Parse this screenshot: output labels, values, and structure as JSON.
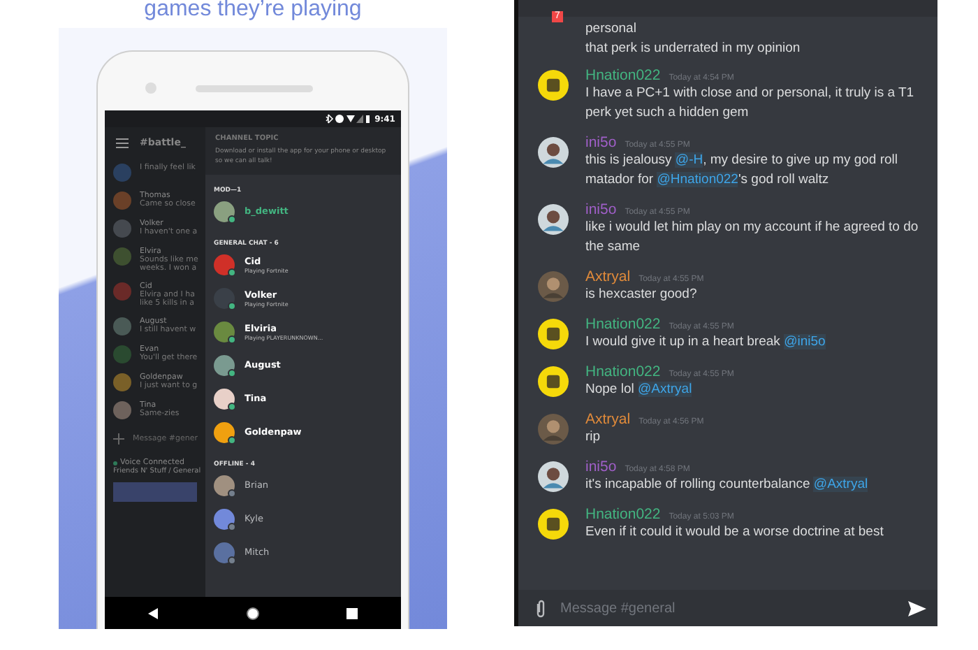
{
  "promo": {
    "headline": "games they’re playing"
  },
  "phone": {
    "status_time": "9:41",
    "chat": {
      "channel": "#battle_",
      "messages": [
        {
          "lines": [
            "I finally feel lik"
          ],
          "color": "#2a4060"
        },
        {
          "author": "Thomas",
          "lines": [
            "Came so close"
          ],
          "color": "#6a4028"
        },
        {
          "author": "Volker",
          "lines": [
            "I haven't one a"
          ],
          "color": "#45494f"
        },
        {
          "author": "Elvira",
          "lines": [
            "Sounds like me",
            "weeks. I won a"
          ],
          "color": "#3e5030"
        },
        {
          "author": "Cid",
          "lines": [
            "Elvira and I ha",
            "like 5 kills in a"
          ],
          "color": "#6a2a28"
        },
        {
          "author": "August",
          "lines": [
            "I still havent w"
          ],
          "color": "#4a5a56"
        },
        {
          "author": "Evan",
          "lines": [
            "You'll get there"
          ],
          "color": "#2a4a30"
        },
        {
          "author": "Goldenpaw",
          "lines": [
            "I just want to g"
          ],
          "color": "#7a6028"
        },
        {
          "author": "Tina",
          "lines": [
            "Same-zies"
          ],
          "color": "#6e625c"
        }
      ],
      "input_placeholder": "Message #gener",
      "voice_status": "Voice Connected",
      "voice_channel": "Friends N' Stuff / General"
    },
    "drawer": {
      "topic_heading": "CHANNEL TOPIC",
      "topic": "Download or install the app for your phone or desktop so we can all talk!",
      "groups": [
        {
          "heading": "MOD—1",
          "members": [
            {
              "name": "b_dewitt",
              "online": true,
              "highlight": true,
              "color": "#8aa080"
            }
          ]
        },
        {
          "heading": "GENERAL CHAT - 6",
          "members": [
            {
              "name": "Cid",
              "activity": "Playing Fortnite",
              "online": true,
              "highlight": false,
              "color": "#d03028"
            },
            {
              "name": "Volker",
              "activity": "Playing Fortnite",
              "online": true,
              "highlight": false,
              "color": "#3a4048"
            },
            {
              "name": "Elviria",
              "activity": "Playing PLAYERUNKNOWN...",
              "online": true,
              "highlight": false,
              "color": "#6a8a40"
            },
            {
              "name": "August",
              "online": true,
              "highlight": false,
              "color": "#7a9a90"
            },
            {
              "name": "Tina",
              "online": true,
              "highlight": false,
              "color": "#e8d0c8"
            },
            {
              "name": "Goldenpaw",
              "online": true,
              "highlight": false,
              "color": "#f0a010"
            }
          ]
        },
        {
          "heading": "OFFLINE - 4",
          "members": [
            {
              "name": "Brian",
              "online": false,
              "highlight": false,
              "color": "#a09080"
            },
            {
              "name": "Kyle",
              "online": false,
              "highlight": false,
              "color": "#7289da"
            },
            {
              "name": "Mitch",
              "online": false,
              "highlight": false,
              "color": "#5a70a0"
            }
          ]
        }
      ]
    }
  },
  "chat": {
    "badge": "7",
    "continuation": [
      "personal",
      "that perk is underrated in my opinion"
    ],
    "messages": [
      {
        "author": "Hnation022",
        "color": "#43b581",
        "kind": "logo",
        "time": "Today at 4:54 PM",
        "parts": [
          {
            "kind": "text",
            "text": "I have a PC+1 with close and or personal, it truly is a T1 perk yet such a hidden gem"
          }
        ]
      },
      {
        "author": "ini5o",
        "color": "#a05fc8",
        "kind": "person",
        "time": "Today at 4:55 PM",
        "parts": [
          {
            "kind": "text",
            "text": "this is jealousy "
          },
          {
            "kind": "mention",
            "text": "@-H"
          },
          {
            "kind": "text",
            "text": ", my desire to give up my god roll matador for "
          },
          {
            "kind": "mention",
            "text": "@Hnation022"
          },
          {
            "kind": "text",
            "text": "'s god roll waltz"
          }
        ]
      },
      {
        "author": "ini5o",
        "color": "#a05fc8",
        "kind": "person",
        "time": "Today at 4:55 PM",
        "parts": [
          {
            "kind": "text",
            "text": "like i would let him play on my account if he agreed to do the same"
          }
        ]
      },
      {
        "author": "Axtryal",
        "color": "#e08a3a",
        "kind": "character",
        "time": "Today at 4:55 PM",
        "parts": [
          {
            "kind": "text",
            "text": "is hexcaster good?"
          }
        ]
      },
      {
        "author": "Hnation022",
        "color": "#43b581",
        "kind": "logo",
        "time": "Today at 4:55 PM",
        "parts": [
          {
            "kind": "text",
            "text": "I would give it up in a heart break "
          },
          {
            "kind": "mention",
            "text": "@ini5o"
          }
        ]
      },
      {
        "author": "Hnation022",
        "color": "#43b581",
        "kind": "logo",
        "time": "Today at 4:55 PM",
        "parts": [
          {
            "kind": "text",
            "text": "Nope lol "
          },
          {
            "kind": "mention",
            "text": "@Axtryal"
          }
        ]
      },
      {
        "author": "Axtryal",
        "color": "#e08a3a",
        "kind": "character",
        "time": "Today at 4:56 PM",
        "parts": [
          {
            "kind": "text",
            "text": "rip"
          }
        ]
      },
      {
        "author": "ini5o",
        "color": "#a05fc8",
        "kind": "person",
        "time": "Today at 4:58 PM",
        "parts": [
          {
            "kind": "text",
            "text": "it's incapable of rolling counterbalance "
          },
          {
            "kind": "mention",
            "text": "@Axtryal"
          }
        ]
      },
      {
        "author": "Hnation022",
        "color": "#43b581",
        "kind": "logo",
        "time": "Today at 5:03 PM",
        "parts": [
          {
            "kind": "text",
            "text": "Even if it could it would be a worse doctrine at best"
          }
        ]
      }
    ],
    "input_placeholder": "Message #general"
  }
}
